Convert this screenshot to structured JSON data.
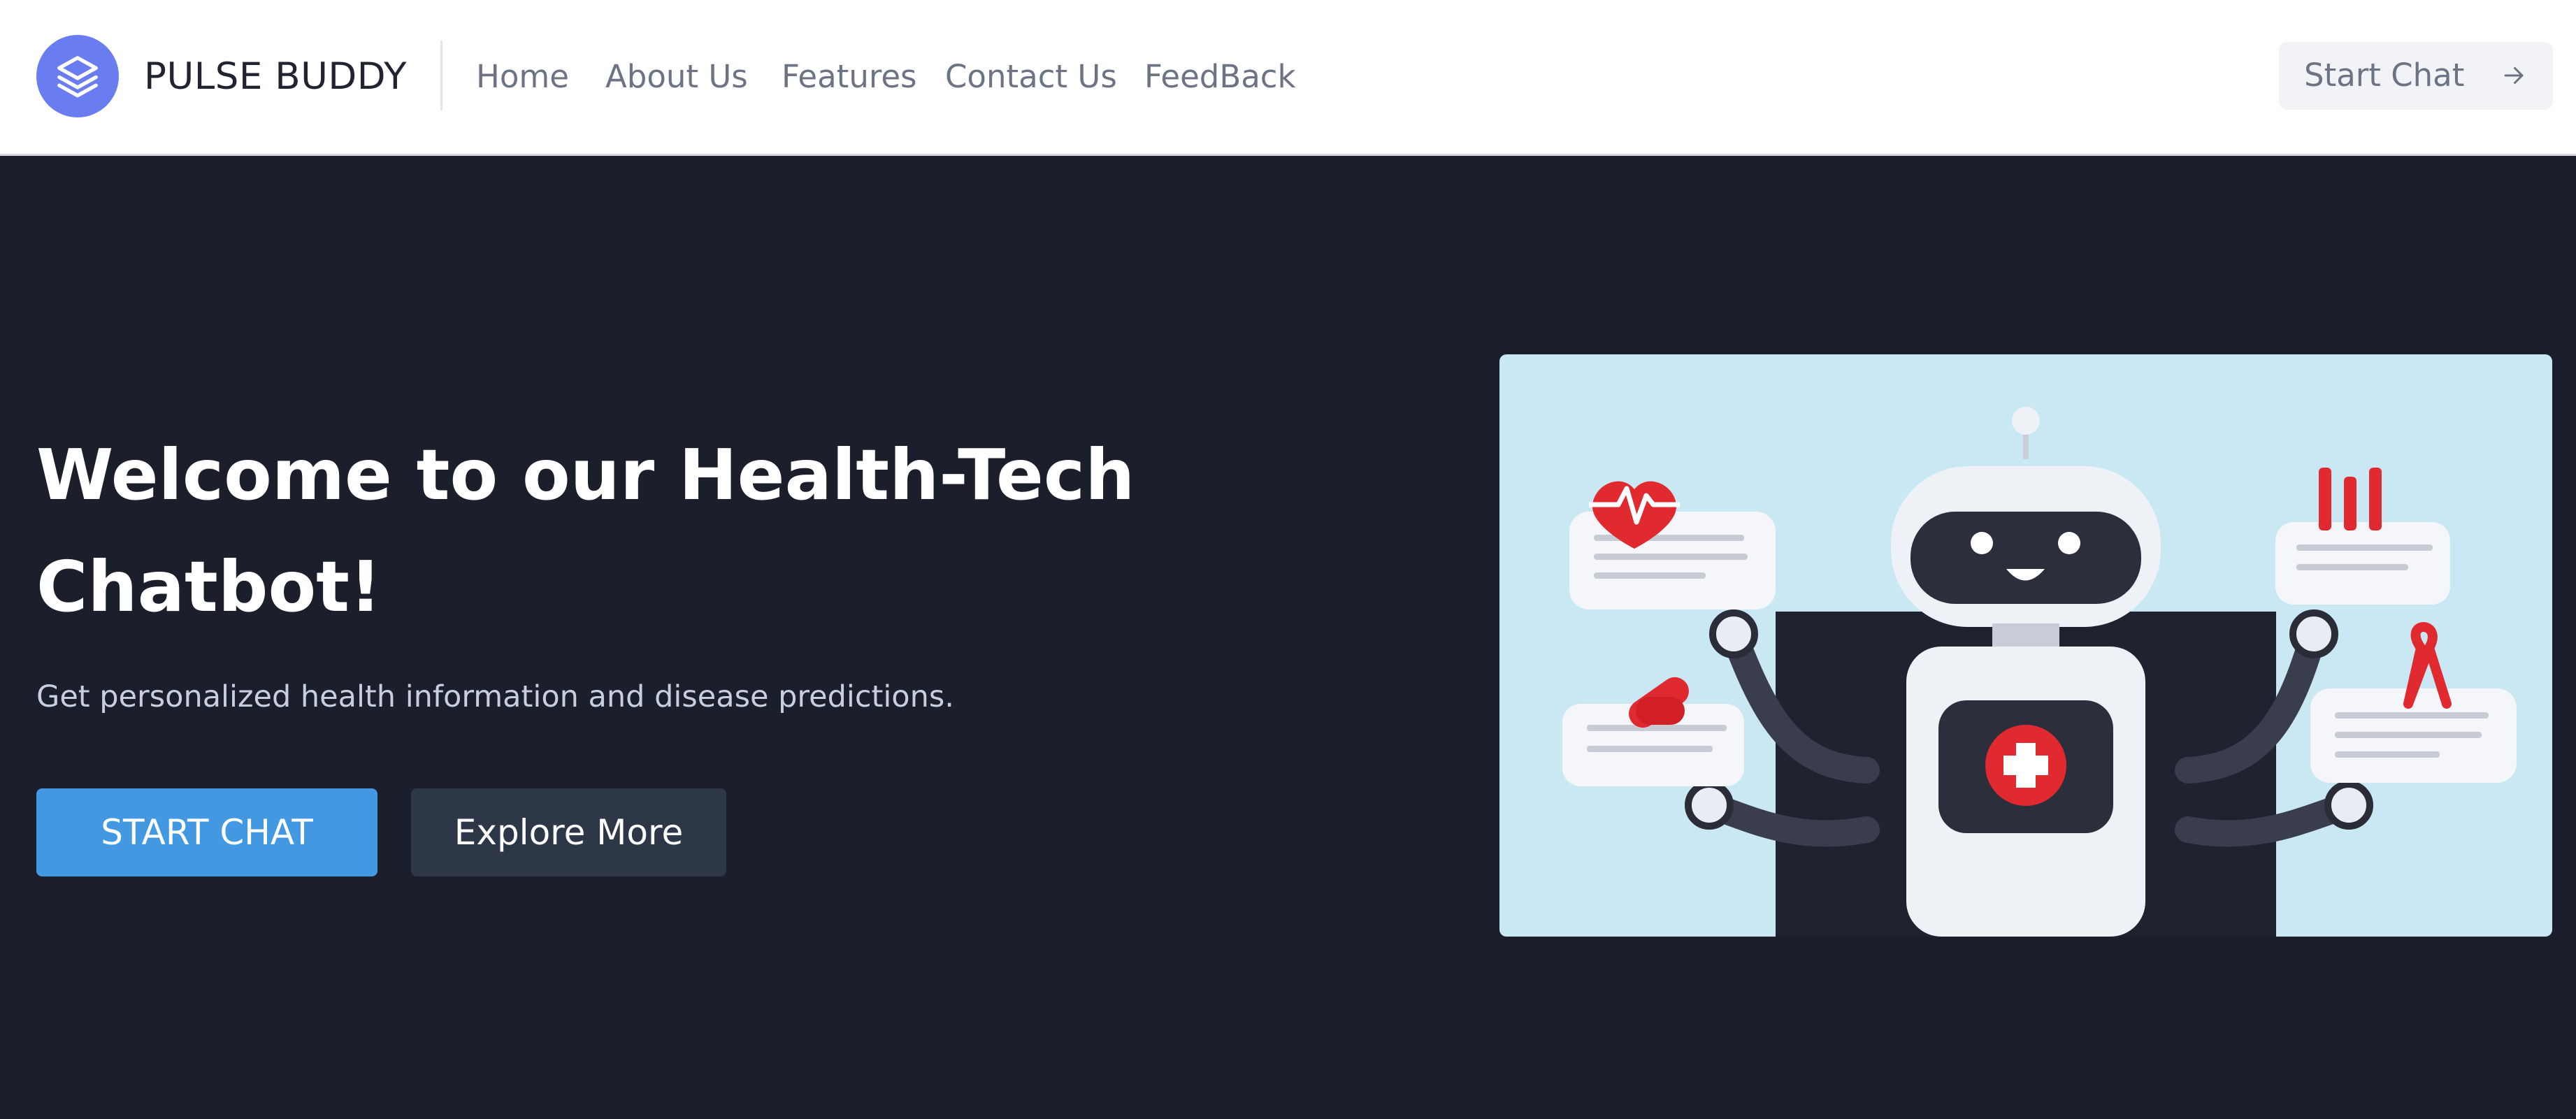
{
  "header": {
    "brand": "PULSE BUDDY",
    "logo_icon": "layers-icon",
    "nav": [
      {
        "label": "Home"
      },
      {
        "label": "About Us"
      },
      {
        "label": "Features"
      },
      {
        "label": "Contact Us"
      },
      {
        "label": "FeedBack"
      }
    ],
    "cta": {
      "label": "Start Chat",
      "icon": "arrow-right-icon"
    }
  },
  "hero": {
    "title": "Welcome to our Health-Tech Chatbot!",
    "subtitle": "Get personalized health information and disease predictions.",
    "primary_button": "START CHAT",
    "secondary_button": "Explore More",
    "illustration": "medical-robot-illustration"
  },
  "colors": {
    "header_bg": "#ffffff",
    "hero_bg": "#1b1f2b",
    "brand_accent": "#6a7df0",
    "primary_button": "#4299e1",
    "secondary_button": "#2d3748",
    "illustration_bg": "#c9e8f3",
    "medical_red": "#e02a2f"
  }
}
